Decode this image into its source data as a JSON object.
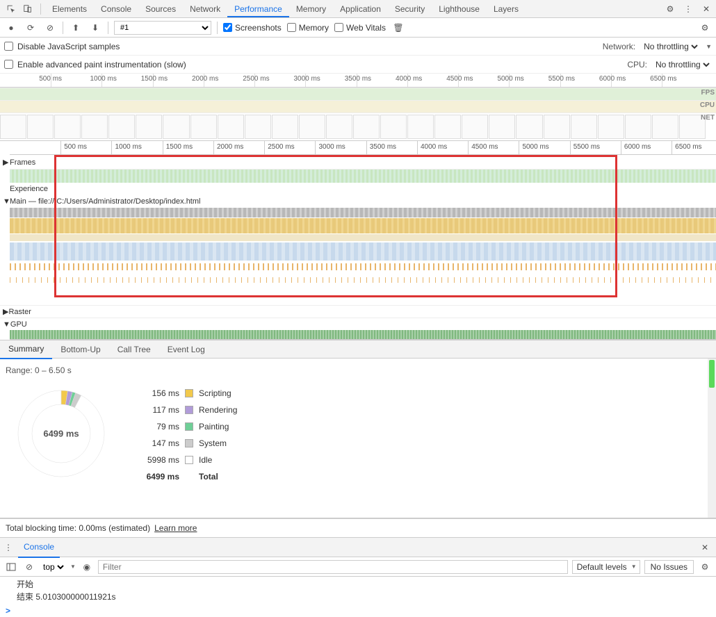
{
  "devtools_tabs": [
    "Elements",
    "Console",
    "Sources",
    "Network",
    "Performance",
    "Memory",
    "Application",
    "Security",
    "Lighthouse",
    "Layers"
  ],
  "active_tab": "Performance",
  "toolbar": {
    "profile_select": "#1",
    "screenshots": "Screenshots",
    "memory": "Memory",
    "web_vitals": "Web Vitals"
  },
  "settings": {
    "disable_js_samples": "Disable JavaScript samples",
    "enable_paint": "Enable advanced paint instrumentation (slow)",
    "network_label": "Network:",
    "network_value": "No throttling",
    "cpu_label": "CPU:",
    "cpu_value": "No throttling"
  },
  "ruler_ticks": [
    "500 ms",
    "1000 ms",
    "1500 ms",
    "2000 ms",
    "2500 ms",
    "3000 ms",
    "3500 ms",
    "4000 ms",
    "4500 ms",
    "5000 ms",
    "5500 ms",
    "6000 ms",
    "6500 ms"
  ],
  "overview_labels": {
    "fps": "FPS",
    "cpu": "CPU",
    "net": "NET"
  },
  "tracks": {
    "frames": "Frames",
    "experience": "Experience",
    "main": "Main — file:///C:/Users/Administrator/Desktop/index.html",
    "raster": "Raster",
    "gpu": "GPU"
  },
  "details_tabs": [
    "Summary",
    "Bottom-Up",
    "Call Tree",
    "Event Log"
  ],
  "active_details_tab": "Summary",
  "summary": {
    "range": "Range: 0 – 6.50 s",
    "total_label": "6499 ms",
    "rows": [
      {
        "ms": "156 ms",
        "color": "#f2c94c",
        "name": "Scripting"
      },
      {
        "ms": "117 ms",
        "color": "#b19cd9",
        "name": "Rendering"
      },
      {
        "ms": "79 ms",
        "color": "#6fcf97",
        "name": "Painting"
      },
      {
        "ms": "147 ms",
        "color": "#cccccc",
        "name": "System"
      },
      {
        "ms": "5998 ms",
        "color": "#ffffff",
        "name": "Idle"
      }
    ],
    "total_row": {
      "ms": "6499 ms",
      "name": "Total"
    }
  },
  "blocking": {
    "text": "Total blocking time: 0.00ms (estimated)",
    "link": "Learn more"
  },
  "console": {
    "tab": "Console",
    "context": "top",
    "filter_placeholder": "Filter",
    "levels": "Default levels",
    "issues": "No Issues",
    "lines": [
      "开始",
      "结束 5.010300000011921s"
    ],
    "prompt": ">"
  },
  "chart_data": {
    "type": "pie",
    "title": "Range: 0 – 6.50 s",
    "series": [
      {
        "name": "Scripting",
        "value": 156,
        "color": "#f2c94c"
      },
      {
        "name": "Rendering",
        "value": 117,
        "color": "#b19cd9"
      },
      {
        "name": "Painting",
        "value": 79,
        "color": "#6fcf97"
      },
      {
        "name": "System",
        "value": 147,
        "color": "#cccccc"
      },
      {
        "name": "Idle",
        "value": 5998,
        "color": "#ffffff"
      }
    ],
    "total": 6499,
    "unit": "ms"
  }
}
